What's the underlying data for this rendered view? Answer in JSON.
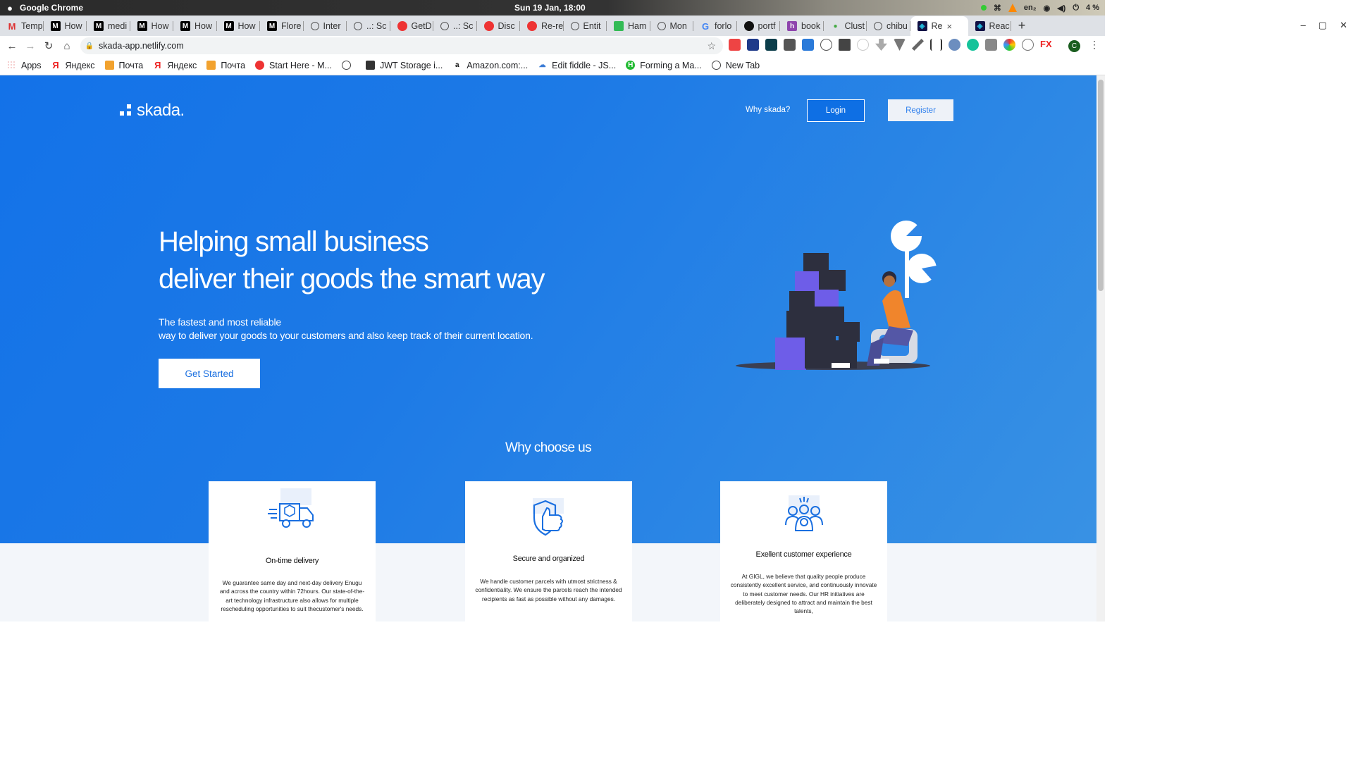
{
  "system": {
    "app_name": "Google Chrome",
    "clock": "Sun 19 Jan, 18:00",
    "keyboard": "en₂",
    "battery": "4 %"
  },
  "tabs": [
    {
      "label": "Temp",
      "icon": "gmail-icon"
    },
    {
      "label": "How",
      "icon": "medium-icon"
    },
    {
      "label": "medi",
      "icon": "medium-icon"
    },
    {
      "label": "How",
      "icon": "medium-icon"
    },
    {
      "label": "How",
      "icon": "medium-icon"
    },
    {
      "label": "How",
      "icon": "medium-icon"
    },
    {
      "label": "Flore",
      "icon": "medium-icon"
    },
    {
      "label": "Inter",
      "icon": "globe-icon"
    },
    {
      "label": "..: Sc",
      "icon": "globe-icon"
    },
    {
      "label": "GetD",
      "icon": "red-icon"
    },
    {
      "label": "..: Sc",
      "icon": "globe-icon"
    },
    {
      "label": "Disc",
      "icon": "discord-icon"
    },
    {
      "label": "Re-re",
      "icon": "red-icon"
    },
    {
      "label": "Entit",
      "icon": "globe-icon"
    },
    {
      "label": "Ham",
      "icon": "hamster-icon"
    },
    {
      "label": "Mon",
      "icon": "globe-icon"
    },
    {
      "label": "forlo",
      "icon": "google-icon"
    },
    {
      "label": "portf",
      "icon": "github-icon"
    },
    {
      "label": "book",
      "icon": "heroku-icon"
    },
    {
      "label": "Clust",
      "icon": "mongodb-icon"
    },
    {
      "label": "chibu",
      "icon": "globe-icon"
    }
  ],
  "active_tab": {
    "label": "Re",
    "close": "×"
  },
  "after_tab": {
    "label": "Reac"
  },
  "toolbar": {
    "url": "skada-app.netlify.com"
  },
  "bookmarks": [
    {
      "label": "Apps"
    },
    {
      "label": "Яндекс"
    },
    {
      "label": "Почта"
    },
    {
      "label": "Яндекс"
    },
    {
      "label": "Почта"
    },
    {
      "label": "Start Here - M..."
    },
    {
      "label": ""
    },
    {
      "label": "JWT Storage i..."
    },
    {
      "label": "Amazon.com:..."
    },
    {
      "label": "Edit fiddle - JS..."
    },
    {
      "label": "Forming a Ma..."
    },
    {
      "label": "New Tab"
    }
  ],
  "site": {
    "logo": "skada.",
    "nav_why": "Why skada?",
    "login": "Login",
    "register": "Register",
    "hero_line1": "Helping small business",
    "hero_line2": "deliver their goods the smart way",
    "sub_line1": "The fastest and most reliable",
    "sub_line2": "way to deliver your goods to your customers and also keep track of their current location.",
    "cta": "Get Started",
    "why_title": "Why choose us",
    "cards": [
      {
        "title": "On-time delivery",
        "text": "We guarantee same day and next-day delivery Enugu and across the country within 72hours. Our state-of-the-art technology infrastructure also allows for multiple rescheduling opportunities to suit thecustomer's needs."
      },
      {
        "title": "Secure and organized",
        "text": "We handle customer parcels with utmost strictness & confidentiality. We ensure the parcels reach the intended recipients as fast as possible without any damages."
      },
      {
        "title": "Exellent customer experience",
        "text": "At GIGL, we believe that quality people produce consistently excellent service, and continuously innovate to meet customer needs. Our HR initiatives are deliberately designed to attract and maintain the best talents,"
      }
    ]
  },
  "colors": {
    "brand_blue": "#1372e8",
    "accent": "#2f80ed"
  }
}
